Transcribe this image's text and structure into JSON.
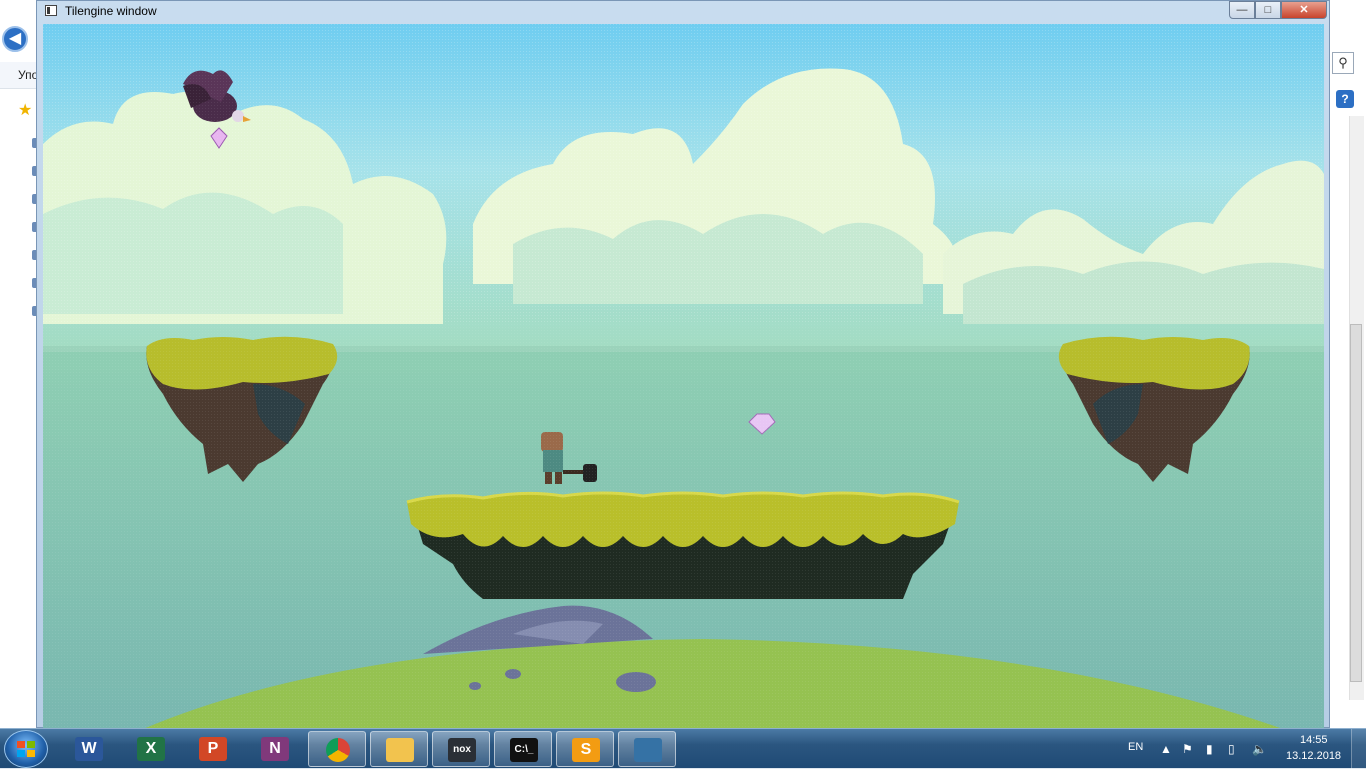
{
  "window": {
    "title": "Tilengine window"
  },
  "background_window": {
    "menu_label": "Упо"
  },
  "taskbar": {
    "apps": [
      {
        "name": "word",
        "glyph": "W",
        "color": "#2b579a"
      },
      {
        "name": "excel",
        "glyph": "X",
        "color": "#217346"
      },
      {
        "name": "powerpoint",
        "glyph": "P",
        "color": "#d24726"
      },
      {
        "name": "onenote",
        "glyph": "N",
        "color": "#80397b"
      },
      {
        "name": "chrome",
        "glyph": "",
        "color": "#db4437"
      },
      {
        "name": "file-explorer",
        "glyph": "",
        "color": "#f2c34e"
      },
      {
        "name": "nox",
        "glyph": "nox",
        "color": "#2a2f36"
      },
      {
        "name": "command-prompt",
        "glyph": "C:\\_",
        "color": "#111111"
      },
      {
        "name": "sublime-text",
        "glyph": "S",
        "color": "#f39c12"
      },
      {
        "name": "python",
        "glyph": "",
        "color": "#3572a5"
      }
    ],
    "tray": {
      "lang": "EN",
      "time": "14:55",
      "date": "13.12.2018"
    }
  },
  "colors": {
    "sky_top": "#7fd2ee",
    "sea": "#7fbfb1",
    "grass": "#b5bf2e",
    "hill": "#8fbf4f"
  }
}
